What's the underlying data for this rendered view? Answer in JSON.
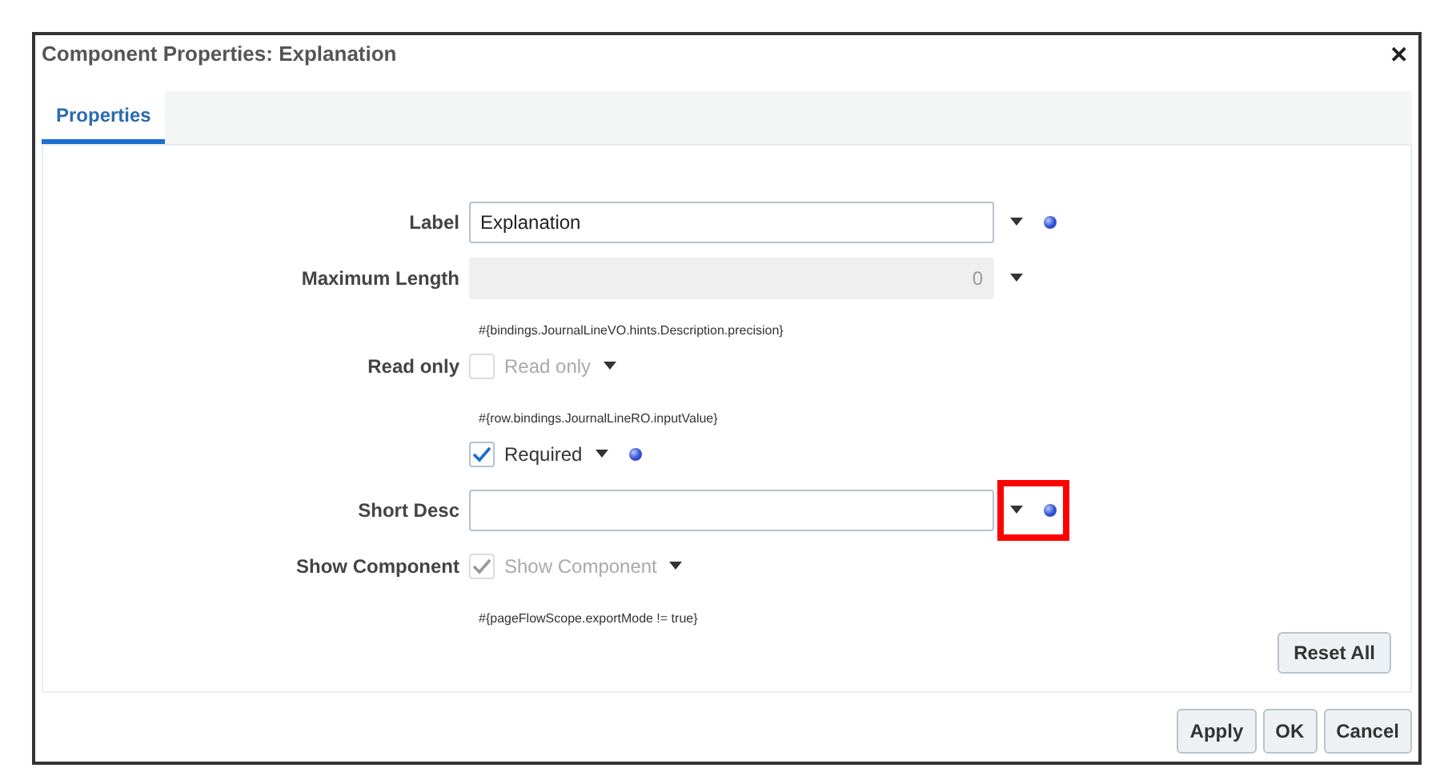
{
  "window": {
    "title": "Component Properties: Explanation",
    "close": "✕"
  },
  "tabs": [
    {
      "label": "Properties",
      "selected": true
    }
  ],
  "rows": [
    {
      "kind": "text",
      "label": "Label",
      "value": "Explanation",
      "disabled": false,
      "dot": true,
      "highlighted": false
    },
    {
      "kind": "text",
      "label": "Maximum Length",
      "value": "0",
      "disabled": true,
      "dot": false,
      "highlighted": false,
      "hint": "#{bindings.JournalLineVO.hints.Description.precision}"
    },
    {
      "kind": "checkbox",
      "label": "Read only",
      "text": "Read only",
      "checked": false,
      "disabled": true,
      "dot": false,
      "hint": "#{row.bindings.JournalLineRO.inputValue}"
    },
    {
      "kind": "checkbox",
      "text": "Required",
      "checked": true,
      "disabled": false,
      "dot": true
    },
    {
      "kind": "text",
      "label": "Short Desc",
      "disabled": false,
      "dot": true,
      "highlighted": true
    },
    {
      "kind": "checkbox",
      "label": "Show Component",
      "text": "Show Component",
      "checked": true,
      "disabled": true,
      "dot": false,
      "hint": "#{pageFlowScope.exportMode != true}"
    }
  ],
  "reset_button": "Reset All",
  "buttons": [
    "Apply",
    "OK",
    "Cancel"
  ]
}
